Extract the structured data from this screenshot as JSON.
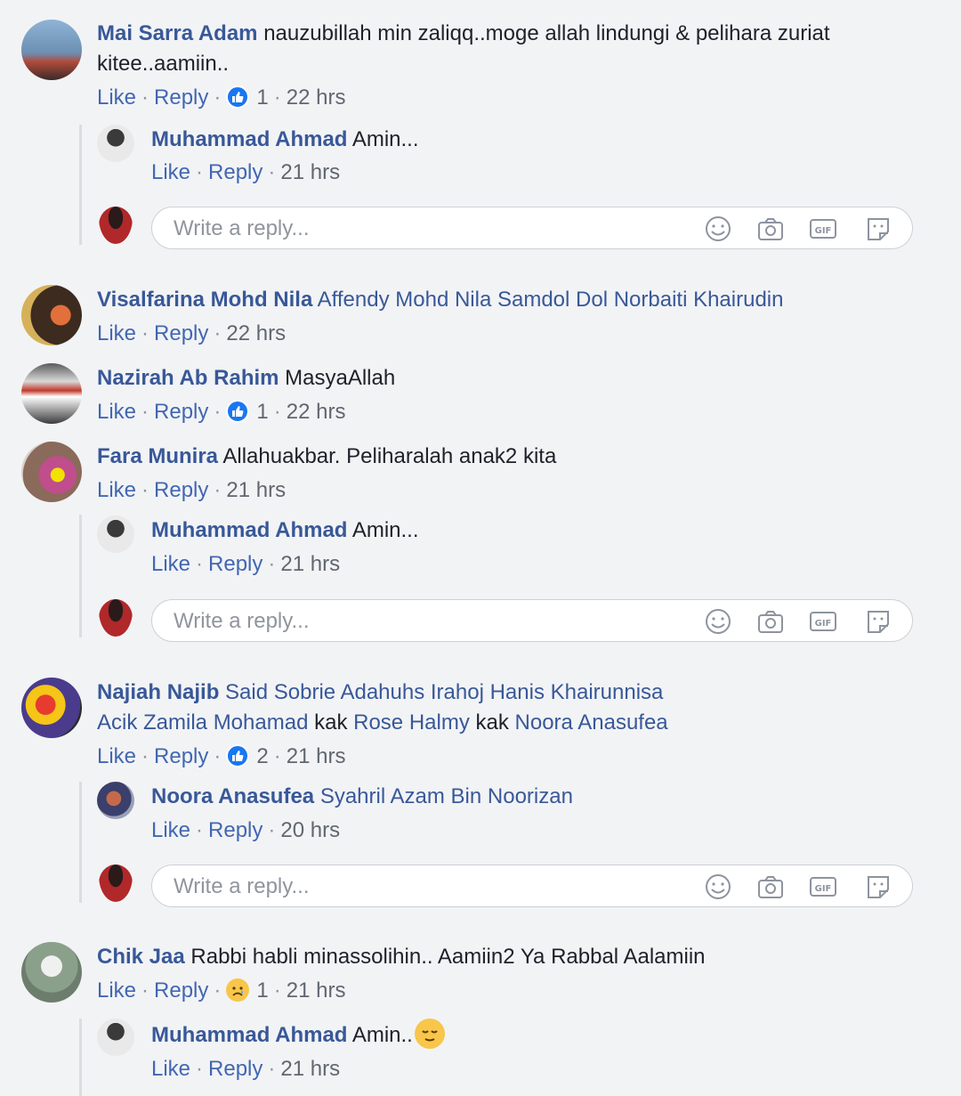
{
  "ui": {
    "like": "Like",
    "reply": "Reply",
    "dot": "·",
    "write_placeholder": "Write a reply..."
  },
  "comments": [
    {
      "name": "Mai Sarra Adam",
      "text_line1": "nauzubillah min zaliqq..moge allah lindungi & pelihara zuriat",
      "text_line2": "kitee..aamiin..",
      "reaction_count": "1",
      "time": "22 hrs",
      "replies": [
        {
          "name": "Muhammad Ahmad",
          "text": "Amin...",
          "time": "21 hrs"
        }
      ]
    },
    {
      "name": "Visalfarina Mohd Nila",
      "tags": "Affendy Mohd Nila Samdol Dol Norbaiti Khairudin",
      "time": "22 hrs"
    },
    {
      "name": "Nazirah Ab Rahim",
      "text": "MasyaAllah",
      "reaction_count": "1",
      "time": "22 hrs"
    },
    {
      "name": "Fara Munira",
      "text": "Allahuakbar. Peliharalah anak2 kita",
      "time": "21 hrs",
      "replies": [
        {
          "name": "Muhammad Ahmad",
          "text": "Amin...",
          "time": "21 hrs"
        }
      ]
    },
    {
      "name": "Najiah Najib",
      "tag1": "Said Sobrie",
      "tag2": "Adahuhs Irahoj",
      "tag3": "Hanis Khairunnisa",
      "tag4": "Acik Zamila Mohamad",
      "word_kak1": "kak",
      "tag5": "Rose Halmy",
      "word_kak2": "kak",
      "tag6": "Noora Anasufea",
      "reaction_count": "2",
      "time": "21 hrs",
      "replies": [
        {
          "name": "Noora Anasufea",
          "tag": "Syahril Azam Bin Noorizan",
          "time": "20 hrs"
        }
      ]
    },
    {
      "name": "Chik Jaa",
      "text": "Rabbi habli minassolihin.. Aamiin2 Ya Rabbal Aalamiin",
      "reaction_count": "1",
      "time": "21 hrs",
      "replies": [
        {
          "name": "Muhammad Ahmad",
          "text": "Amin..",
          "time": "21 hrs"
        }
      ]
    }
  ],
  "colors": {
    "name": "#385898",
    "link": "#4267b2",
    "meta": "#606770",
    "like_blue": "#1877f2"
  }
}
